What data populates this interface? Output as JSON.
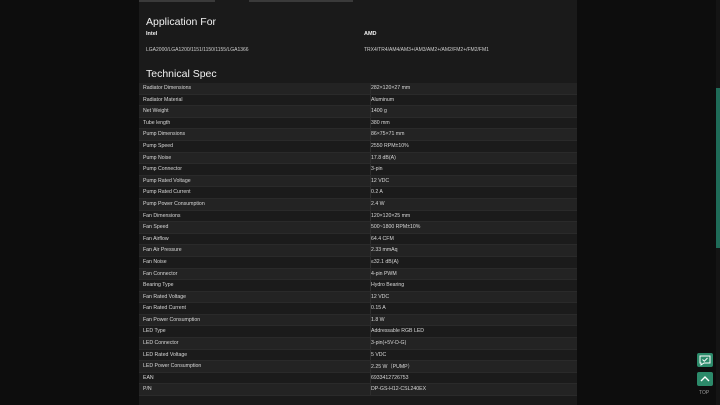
{
  "application": {
    "title": "Application For",
    "intel_label": "Intel",
    "intel_value": "LGA2000/LGA1200/1151/1150/1155/LGA1366",
    "amd_label": "AMD",
    "amd_value": "TRX4/TR4/AM4/AM3+/AM3/AM2+/AM2/FM2+/FM2/FM1"
  },
  "spec": {
    "title": "Technical Spec",
    "rows": [
      {
        "k": "Radiator Dimensions",
        "v": "282×120×27 mm"
      },
      {
        "k": "Radiator Material",
        "v": "Aluminum"
      },
      {
        "k": "Net Weight",
        "v": "1400 g"
      },
      {
        "k": "Tube length",
        "v": "380 mm"
      },
      {
        "k": "Pump Dimensions",
        "v": "86×75×71 mm"
      },
      {
        "k": "Pump Speed",
        "v": "2550 RPM±10%"
      },
      {
        "k": "Pump Noise",
        "v": "17.8 dB(A)"
      },
      {
        "k": "Pump Connector",
        "v": "3-pin"
      },
      {
        "k": "Pump Rated Voltage",
        "v": "12 VDC"
      },
      {
        "k": "Pump Rated Current",
        "v": "0.2 A"
      },
      {
        "k": "Pump Power Consumption",
        "v": "2.4 W"
      },
      {
        "k": "Fan Dimensions",
        "v": "120×120×25 mm"
      },
      {
        "k": "Fan Speed",
        "v": "500~1800 RPM±10%"
      },
      {
        "k": "Fan Airflow",
        "v": "64.4 CFM"
      },
      {
        "k": "Fan Air Pressure",
        "v": "2.33 mmAq"
      },
      {
        "k": "Fan Noise",
        "v": "≤32.1 dB(A)"
      },
      {
        "k": "Fan Connector",
        "v": "4-pin PWM"
      },
      {
        "k": "Bearing Type",
        "v": "Hydro Bearing"
      },
      {
        "k": "Fan Rated Voltage",
        "v": "12 VDC"
      },
      {
        "k": "Fan Rated Current",
        "v": "0.15 A"
      },
      {
        "k": "Fan Power Consumption",
        "v": "1.8 W"
      },
      {
        "k": "LED Type",
        "v": "Addressable RGB LED"
      },
      {
        "k": "LED Connector",
        "v": "3-pin(+5V-D-G)"
      },
      {
        "k": "LED Rated Voltage",
        "v": "5 VDC"
      },
      {
        "k": "LED Power Consumption",
        "v": "2.25 W（PUMP）"
      },
      {
        "k": "EAN",
        "v": "6933412726753"
      },
      {
        "k": "P/N",
        "v": "DP-GS-H12-CSL240EX"
      }
    ]
  },
  "float_buttons": {
    "top_label": "TOP",
    "chat_icon": "chat-check-icon",
    "top_icon": "chevron-up-icon"
  },
  "colors": {
    "accent": "#2c8a6a",
    "panel": "#1a1a1a",
    "page": "#0d0d0d"
  }
}
